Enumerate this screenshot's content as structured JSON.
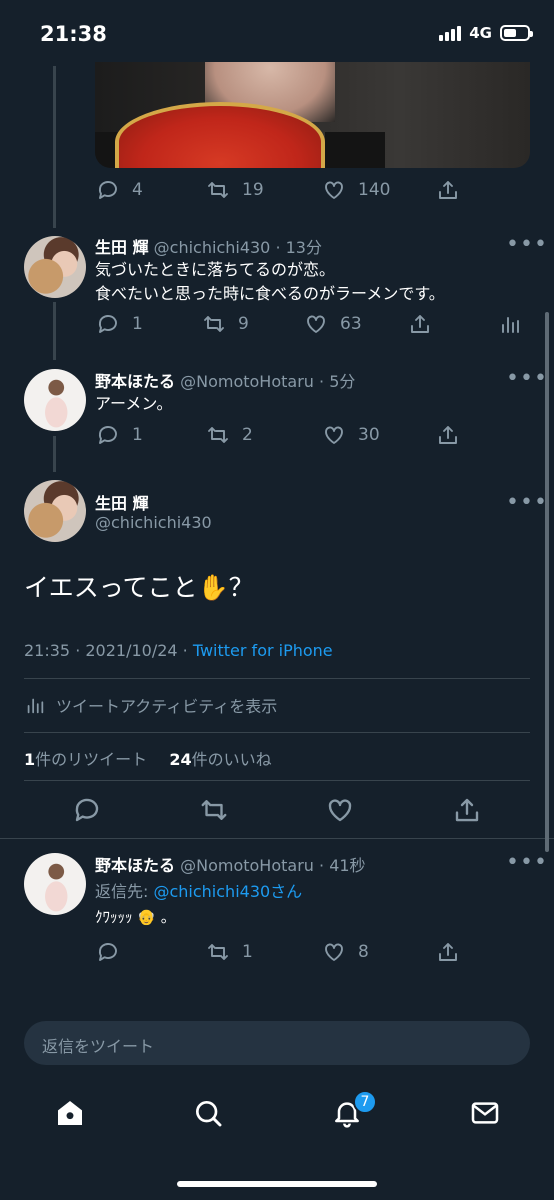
{
  "status_bar": {
    "time": "21:38",
    "network": "4G",
    "battery_level": 0.55
  },
  "tweets": [
    {
      "stats": {
        "replies": "4",
        "retweets": "19",
        "likes": "140"
      }
    },
    {
      "name": "生田 輝",
      "handle": "@chichichi430",
      "time": "· 13分",
      "text_line1": "気づいたときに落ちてるのが恋。",
      "text_line2": "食べたいと思った時に食べるのがラーメンです。",
      "stats": {
        "replies": "1",
        "retweets": "9",
        "likes": "63"
      }
    },
    {
      "name": "野本ほたる",
      "handle": "@NomotoHotaru",
      "time": "· 5分",
      "text": "アーメン。",
      "stats": {
        "replies": "1",
        "retweets": "2",
        "likes": "30"
      }
    }
  ],
  "main_tweet": {
    "name": "生田 輝",
    "handle": "@chichichi430",
    "text": "イエスってこと",
    "emoji": "✋",
    "text_suffix": "？",
    "timestamp": "21:35 · 2021/10/24 · ",
    "source": "Twitter for iPhone",
    "activity_label": "ツイートアクティビティを表示",
    "retweet_count": "1",
    "retweet_label": "件のリツイート",
    "like_count": "24",
    "like_label": "件のいいね"
  },
  "reply": {
    "name": "野本ほたる",
    "handle": "@NomotoHotaru",
    "time": "· 41秒",
    "reply_to_label": "返信先: ",
    "reply_to_handle": "@chichichi430さん",
    "text": "ｸﾜｯｯｯ",
    "emoji": "👴",
    "text_suffix": "。",
    "stats": {
      "replies": "",
      "retweets": "1",
      "likes": "8"
    }
  },
  "compose": {
    "placeholder": "返信をツイート"
  },
  "tab_bar": {
    "notification_count": "7"
  },
  "more_glyph": "•••",
  "colors": {
    "background": "#15202b",
    "accent": "#1d9bf0",
    "muted": "#8899a6",
    "divider": "#38444d"
  }
}
